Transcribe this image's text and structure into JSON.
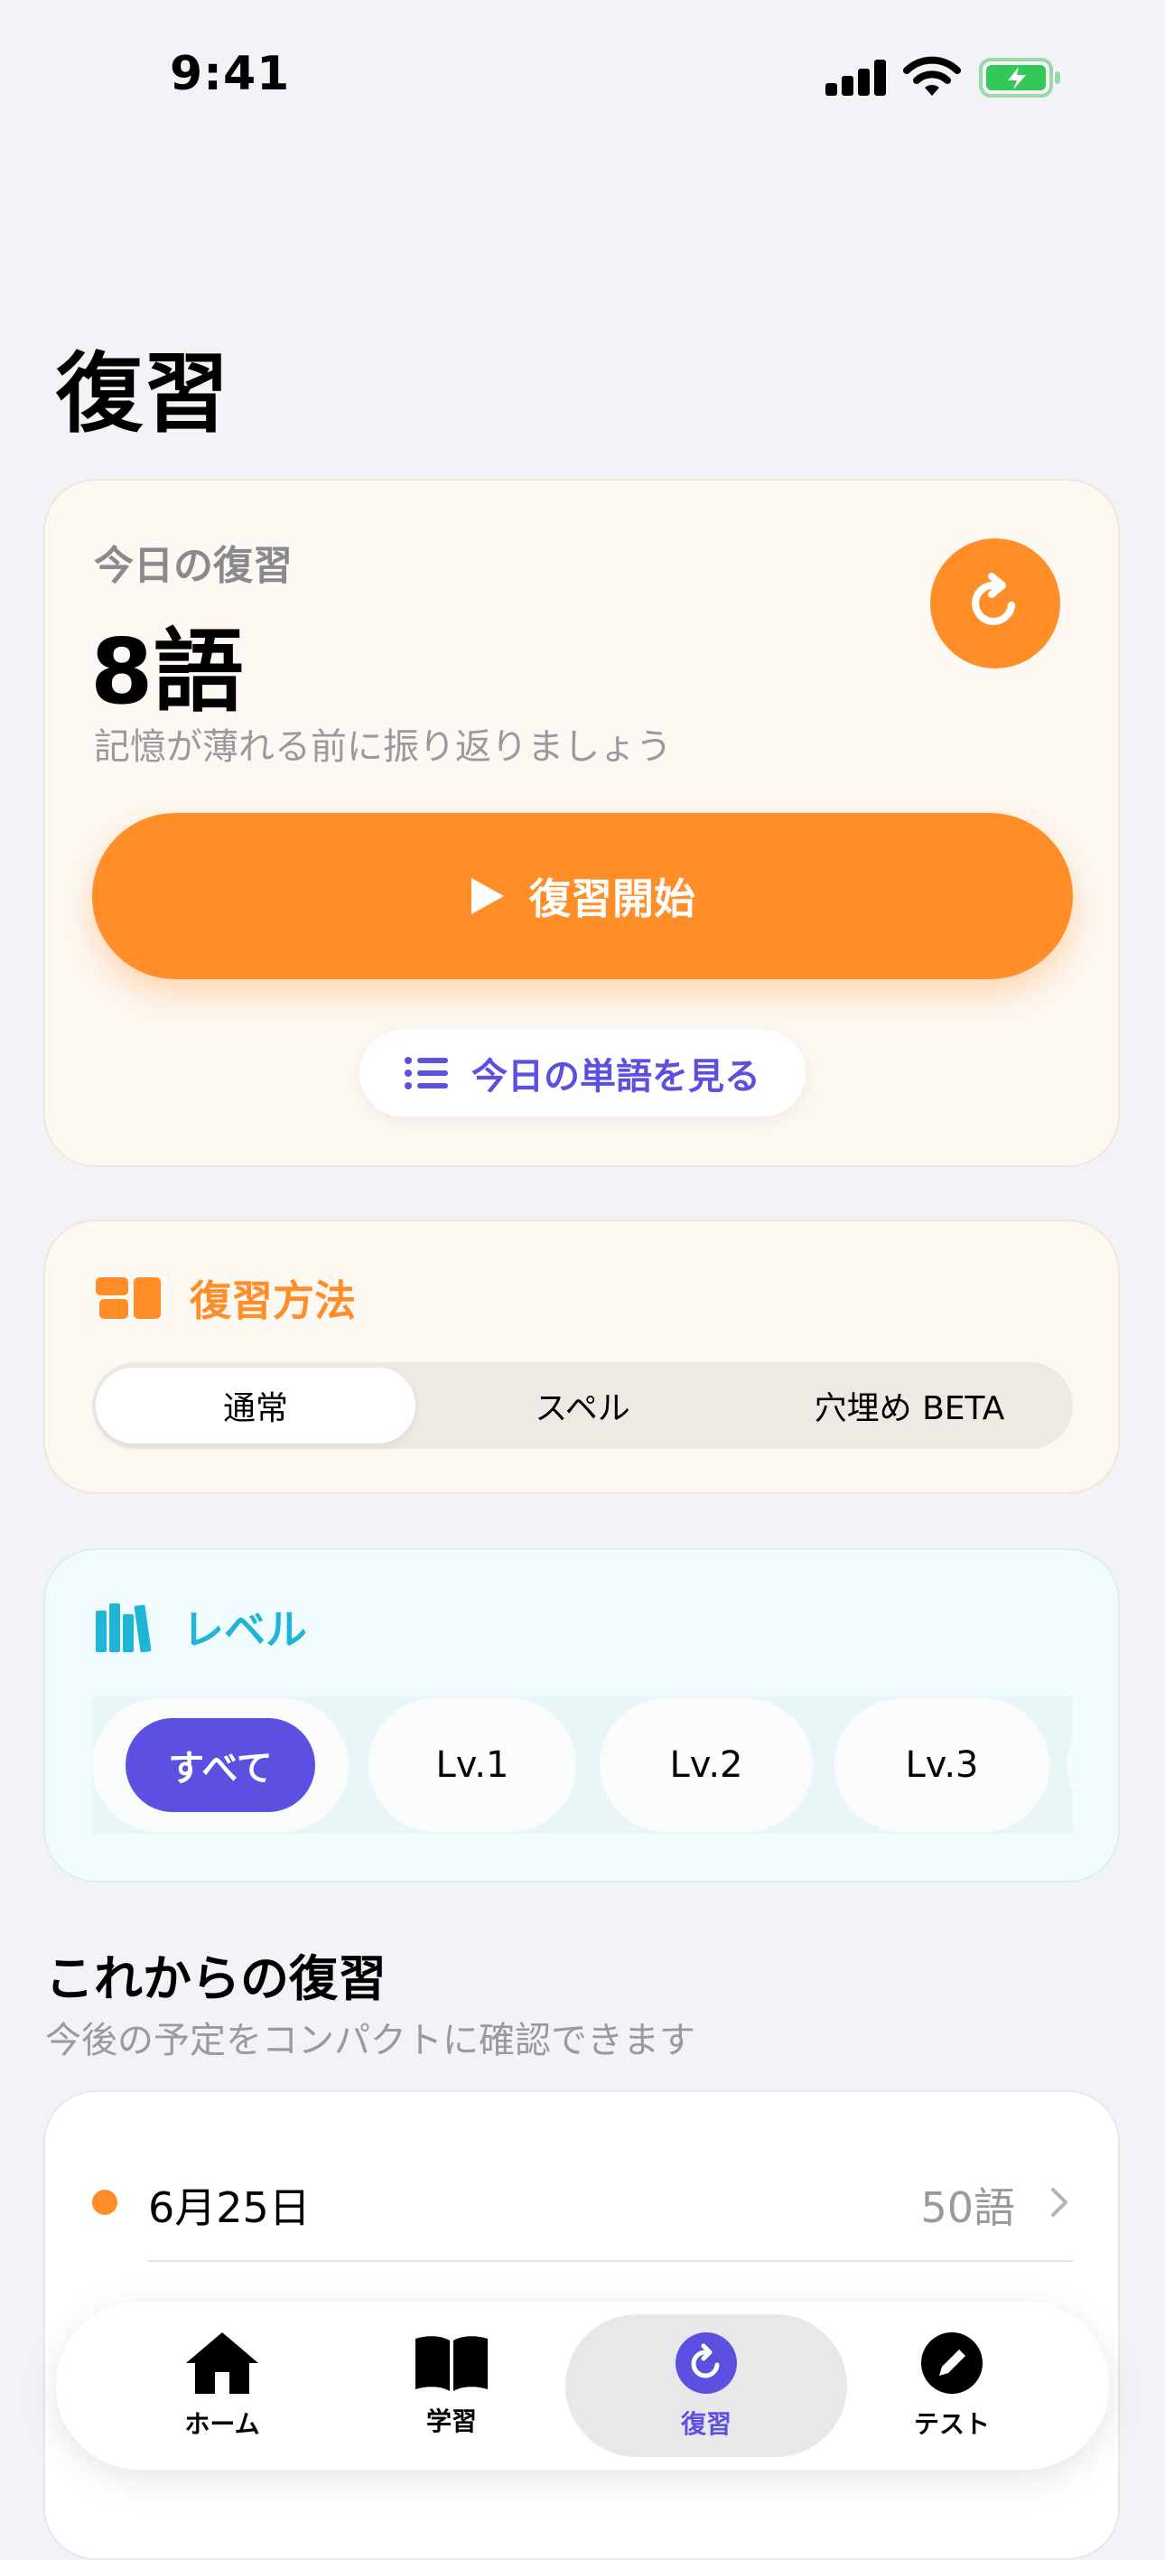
{
  "status_bar": {
    "time": "9:41"
  },
  "page": {
    "title": "復習"
  },
  "today": {
    "label": "今日の復習",
    "count": "8語",
    "subtitle": "記憶が薄れる前に振り返りましょう",
    "start_button": "復習開始",
    "view_words_button": "今日の単語を見る"
  },
  "method": {
    "title": "復習方法",
    "options": [
      "通常",
      "スペル",
      "穴埋め BETA"
    ],
    "selected": "通常"
  },
  "level": {
    "title": "レベル",
    "chips": [
      "すべて",
      "Lv.1",
      "Lv.2",
      "Lv.3"
    ],
    "selected": "すべて"
  },
  "upcoming": {
    "title": "これからの復習",
    "subtitle": "今後の予定をコンパクトに確認できます",
    "rows": [
      {
        "date": "6月25日",
        "count": "50語"
      }
    ]
  },
  "tabbar": {
    "tabs": [
      "ホーム",
      "学習",
      "復習",
      "テスト"
    ],
    "active": "復習"
  },
  "colors": {
    "accent_orange": "#ff8e29",
    "accent_purple": "#5b50e0",
    "accent_cyan": "#1fb5d6",
    "battery_green": "#34c759"
  },
  "icons": [
    "signal-icon",
    "wifi-icon",
    "battery-icon",
    "refresh-icon",
    "play-icon",
    "list-icon",
    "layout-icon",
    "books-icon",
    "chevron-right-icon",
    "home-icon",
    "book-icon",
    "review-icon",
    "pencil-icon"
  ]
}
